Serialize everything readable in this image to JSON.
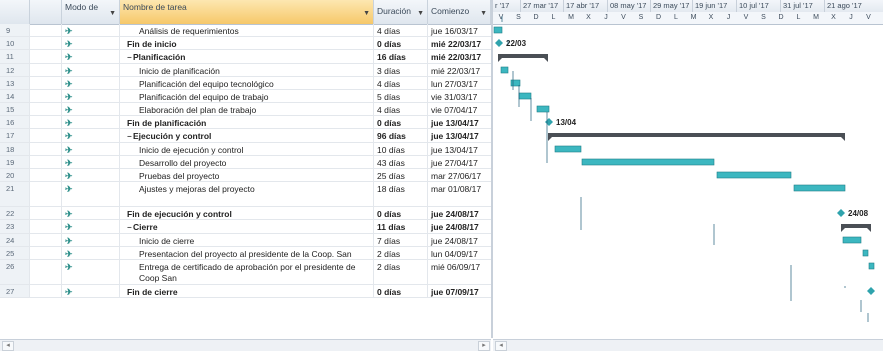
{
  "columns": {
    "mode": "Modo de",
    "name": "Nombre de tarea",
    "duration": "Duración",
    "start": "Comienzo"
  },
  "timeline": {
    "weeks": [
      "r '17",
      "27 mar '17",
      "17 abr '17",
      "08 may '17",
      "29 may '17",
      "19 jun '17",
      "10 jul '17",
      "31 jul '17",
      "21 ago '17"
    ],
    "days": [
      "V",
      "S",
      "D",
      "L",
      "M",
      "X",
      "J",
      "V",
      "S",
      "D",
      "L",
      "M",
      "X",
      "J",
      "V",
      "S",
      "D",
      "L",
      "M",
      "X",
      "J",
      "V"
    ]
  },
  "rows": [
    {
      "id": "9",
      "name": "Análisis de requerimientos",
      "duration": "4 días",
      "start": "jue 16/03/17",
      "level": 2,
      "bold": false
    },
    {
      "id": "10",
      "name": "Fin de inicio",
      "duration": "0 días",
      "start": "mié 22/03/17",
      "level": 1,
      "bold": true
    },
    {
      "id": "11",
      "name": "Planificación",
      "duration": "16 días",
      "start": "mié 22/03/17",
      "level": 1,
      "bold": true,
      "summary": true
    },
    {
      "id": "12",
      "name": "Inicio de planificación",
      "duration": "3 días",
      "start": "mié 22/03/17",
      "level": 2,
      "bold": false
    },
    {
      "id": "13",
      "name": "Planificación del equipo tecnológico",
      "duration": "4 días",
      "start": "lun 27/03/17",
      "level": 2,
      "bold": false
    },
    {
      "id": "14",
      "name": "Planificación del equipo de trabajo",
      "duration": "5 días",
      "start": "vie 31/03/17",
      "level": 2,
      "bold": false
    },
    {
      "id": "15",
      "name": "Elaboración del plan de trabajo",
      "duration": "4 días",
      "start": "vie 07/04/17",
      "level": 2,
      "bold": false
    },
    {
      "id": "16",
      "name": "Fin de planificación",
      "duration": "0 días",
      "start": "jue 13/04/17",
      "level": 1,
      "bold": true
    },
    {
      "id": "17",
      "name": "Ejecución y control",
      "duration": "96 días",
      "start": "jue 13/04/17",
      "level": 1,
      "bold": true,
      "summary": true
    },
    {
      "id": "18",
      "name": "Inicio de ejecución y control",
      "duration": "10 días",
      "start": "jue 13/04/17",
      "level": 2,
      "bold": false
    },
    {
      "id": "19",
      "name": "Desarrollo del proyecto",
      "duration": "43 días",
      "start": "jue 27/04/17",
      "level": 2,
      "bold": false
    },
    {
      "id": "20",
      "name": "Pruebas del proyecto",
      "duration": "25 días",
      "start": "mar 27/06/17",
      "level": 2,
      "bold": false
    },
    {
      "id": "21",
      "name": "Ajustes y mejoras del proyecto",
      "duration": "18 días",
      "start": "mar 01/08/17",
      "level": 2,
      "bold": false
    },
    {
      "id": "22",
      "name": "Fin de ejecución y control",
      "duration": "0 días",
      "start": "jue 24/08/17",
      "level": 1,
      "bold": true
    },
    {
      "id": "23",
      "name": "Cierre",
      "duration": "11 días",
      "start": "jue 24/08/17",
      "level": 1,
      "bold": true,
      "summary": true
    },
    {
      "id": "24",
      "name": "Inicio de cierre",
      "duration": "7 días",
      "start": "jue 24/08/17",
      "level": 2,
      "bold": false
    },
    {
      "id": "25",
      "name": "Presentacion del proyecto al presidente de la Coop. San",
      "duration": "2 días",
      "start": "lun 04/09/17",
      "level": 2,
      "bold": false
    },
    {
      "id": "26",
      "name": "Entrega de certificado de aprobación por el presidente de Coop San",
      "duration": "2 días",
      "start": "mié 06/09/17",
      "level": 2,
      "bold": false
    },
    {
      "id": "27",
      "name": "Fin de cierre",
      "duration": "0 días",
      "start": "jue 07/09/17",
      "level": 1,
      "bold": true
    }
  ],
  "milestones": {
    "m10": "22/03",
    "m16": "13/04",
    "m22": "24/08"
  },
  "colors": {
    "bar": "#3cb7c0",
    "summary": "#4a4f55",
    "milestone": "#2fa3ad"
  }
}
